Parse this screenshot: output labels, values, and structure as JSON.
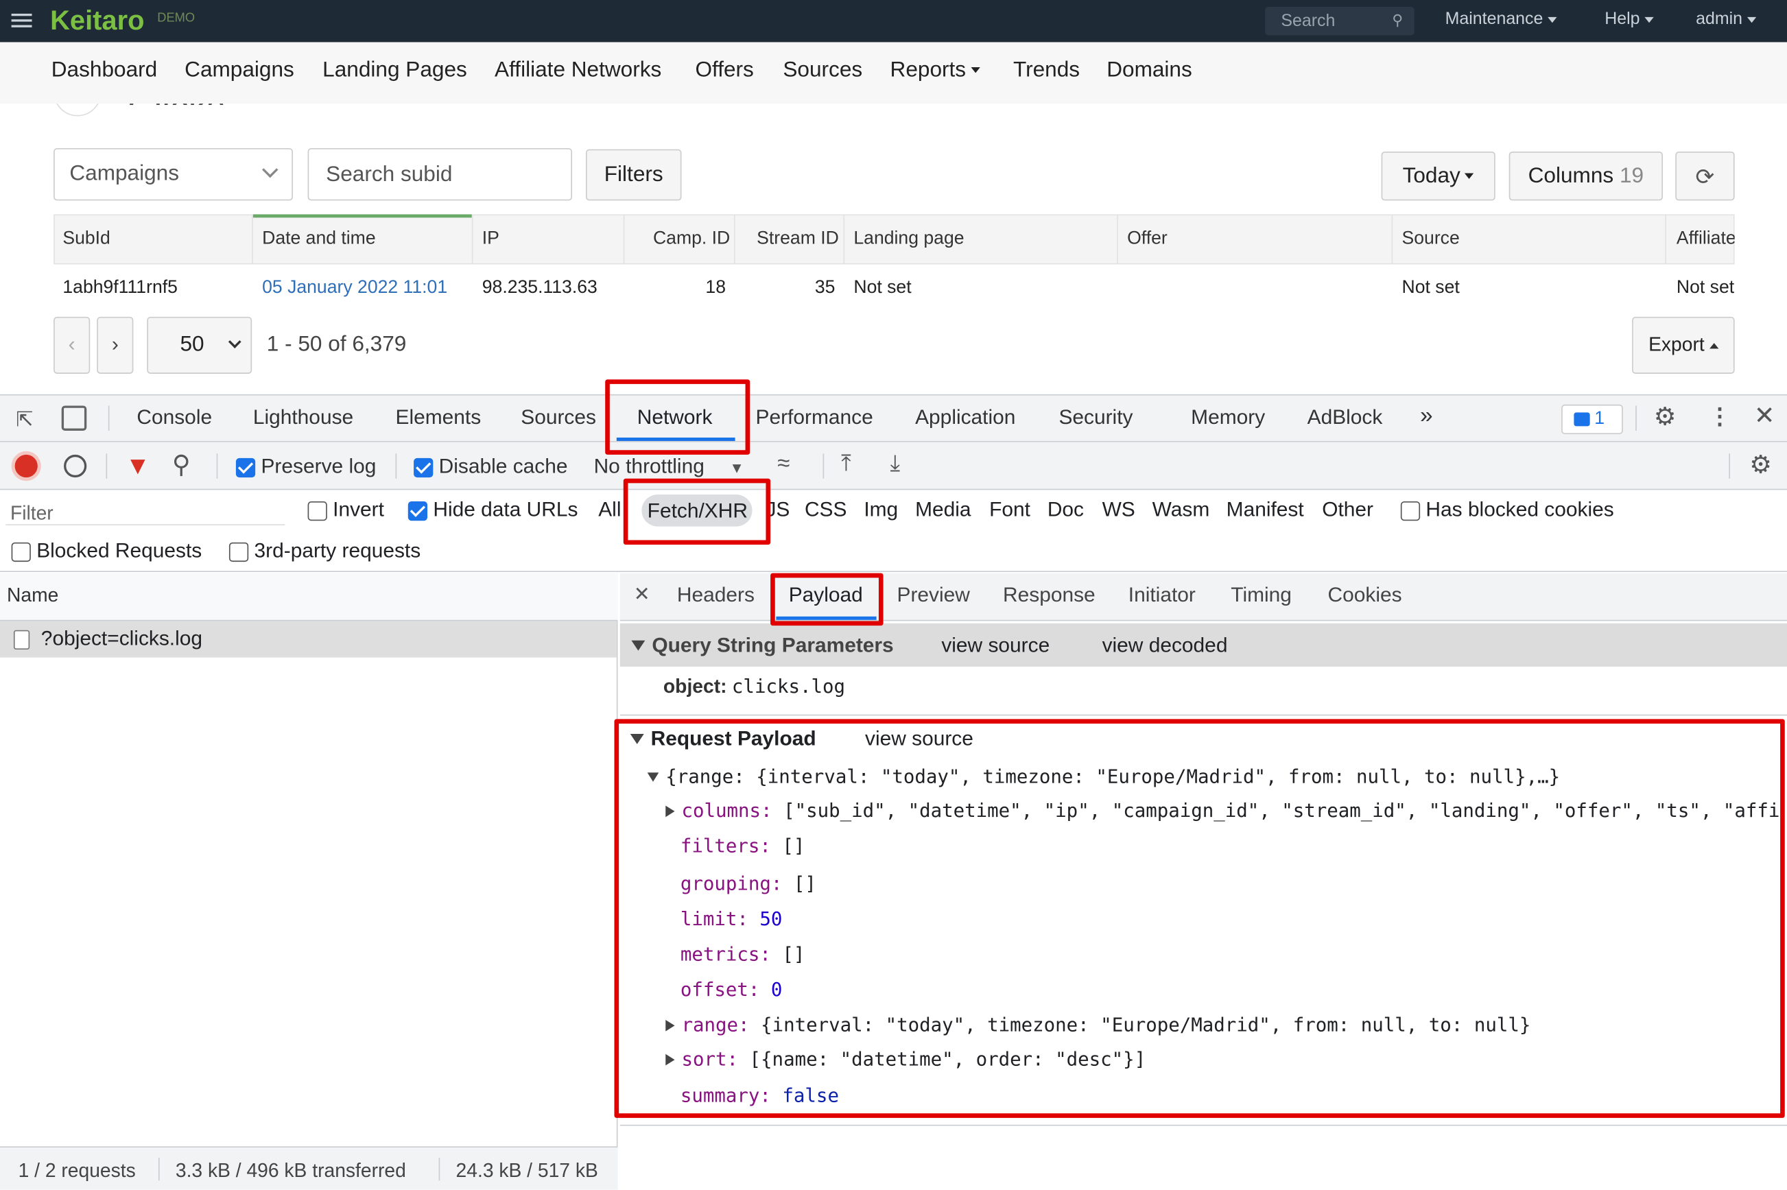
{
  "topbar": {
    "brand": "Keitaro",
    "badge": "DEMO",
    "search_placeholder": "Search",
    "menus": [
      "Maintenance",
      "Help",
      "admin"
    ]
  },
  "nav": [
    "Dashboard",
    "Campaigns",
    "Landing Pages",
    "Affiliate Networks",
    "Offers",
    "Sources",
    "Reports",
    "Trends",
    "Domains"
  ],
  "page": {
    "title": "Clicks",
    "campaign_select": "Campaigns",
    "search_placeholder": "Search subid",
    "filters_label": "Filters",
    "period": "Today",
    "columns_label": "Columns",
    "columns_count": "19"
  },
  "table": {
    "headers": [
      "SubId",
      "Date and time",
      "IP",
      "Camp. ID",
      "Stream ID",
      "Landing page",
      "Offer",
      "Source",
      "Affiliate"
    ],
    "row": [
      "1abh9f111rnf5",
      "05 January 2022 11:01",
      "98.235.113.63",
      "18",
      "35",
      "Not set",
      "",
      "Not set",
      "Not set"
    ]
  },
  "pagination": {
    "prev": "‹",
    "next": "›",
    "per_page": "50",
    "range": "1 - 50 of 6,379",
    "export": "Export"
  },
  "devtools": {
    "tabs": [
      "Console",
      "Lighthouse",
      "Elements",
      "Sources",
      "Network",
      "Performance",
      "Application",
      "Security",
      "Memory",
      "AdBlock"
    ],
    "active_tab": "Network",
    "issues_count": "1",
    "toolbar": {
      "preserve_log": "Preserve log",
      "disable_cache": "Disable cache",
      "throttling": "No throttling"
    },
    "filter": {
      "placeholder": "Filter",
      "invert": "Invert",
      "hide_data_urls": "Hide data URLs",
      "types": [
        "All",
        "Fetch/XHR",
        "JS",
        "CSS",
        "Img",
        "Media",
        "Font",
        "Doc",
        "WS",
        "Wasm",
        "Manifest",
        "Other"
      ],
      "has_blocked_cookies": "Has blocked cookies",
      "blocked_requests": "Blocked Requests",
      "third_party": "3rd-party requests"
    },
    "name_header": "Name",
    "request": "?object=clicks.log",
    "status": {
      "requests": "1 / 2 requests",
      "transferred": "3.3 kB / 496 kB transferred",
      "resources": "24.3 kB / 517 kB"
    },
    "detail_tabs": [
      "Headers",
      "Payload",
      "Preview",
      "Response",
      "Initiator",
      "Timing",
      "Cookies"
    ],
    "active_detail_tab": "Payload",
    "query_string": {
      "title": "Query String Parameters",
      "view_source": "view source",
      "view_decoded": "view decoded",
      "key": "object:",
      "value": "clicks.log"
    },
    "request_payload": {
      "title": "Request Payload",
      "view_source": "view source",
      "summary": "{range: {interval: \"today\", timezone: \"Europe/Madrid\", from: null, to: null},…}",
      "columns_key": "columns:",
      "columns_val": "[\"sub_id\", \"datetime\", \"ip\", \"campaign_id\", \"stream_id\", \"landing\", \"offer\", \"ts\", \"affi",
      "filters_key": "filters:",
      "filters_val": "[]",
      "grouping_key": "grouping:",
      "grouping_val": "[]",
      "limit_key": "limit:",
      "limit_val": "50",
      "metrics_key": "metrics:",
      "metrics_val": "[]",
      "offset_key": "offset:",
      "offset_val": "0",
      "range_key": "range:",
      "range_val": "{interval: \"today\", timezone: \"Europe/Madrid\", from: null, to: null}",
      "sort_key": "sort:",
      "sort_val": "[{name: \"datetime\", order: \"desc\"}]",
      "summary_key": "summary:",
      "summary_val": "false"
    }
  },
  "colors": {
    "highlight": "#e00000",
    "brand": "#7bc043",
    "accent": "#1a73e8"
  }
}
